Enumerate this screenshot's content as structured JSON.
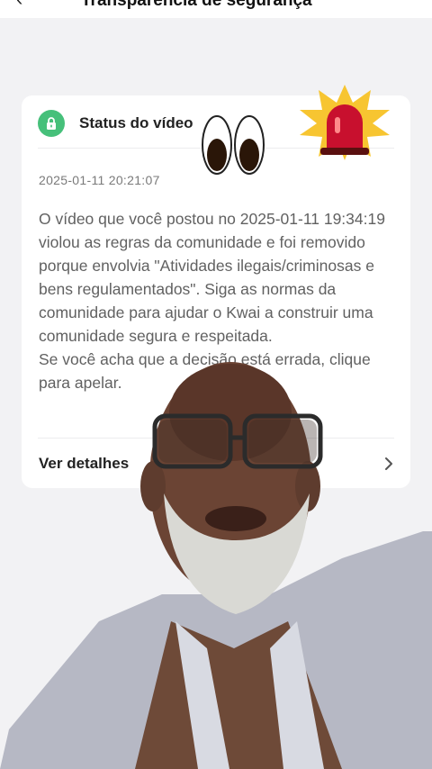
{
  "header": {
    "title": "Transparência de segurança",
    "back_icon": "chevron-left-icon"
  },
  "card": {
    "status_icon": "lock-icon",
    "status_title": "Status do vídeo",
    "timestamp": "2025-01-11 20:21:07",
    "message_lines": [
      "O vídeo que você postou no 2025-01-11 19:34:19 violou as regras da comunidade e foi removido porque envolvia \"Atividades ilegais/criminosas e bens regulamentados\". Siga as normas da comunidade para ajudar o Kwai a construir uma comunidade segura e respeitada.",
      "Se você acha que a decisão está errada, clique para apelar."
    ],
    "details_label": "Ver detalhes",
    "details_icon": "chevron-right-icon"
  },
  "overlays": {
    "eyes_sticker": "eyes-emoji",
    "siren_sticker": "siren-emoji",
    "person_overlay": "man-speaking-photo"
  },
  "colors": {
    "background": "#f2f2f4",
    "card": "#ffffff",
    "lock_badge": "#46c07a",
    "siren_red": "#c8102e",
    "burst_yellow": "#f7c531"
  }
}
